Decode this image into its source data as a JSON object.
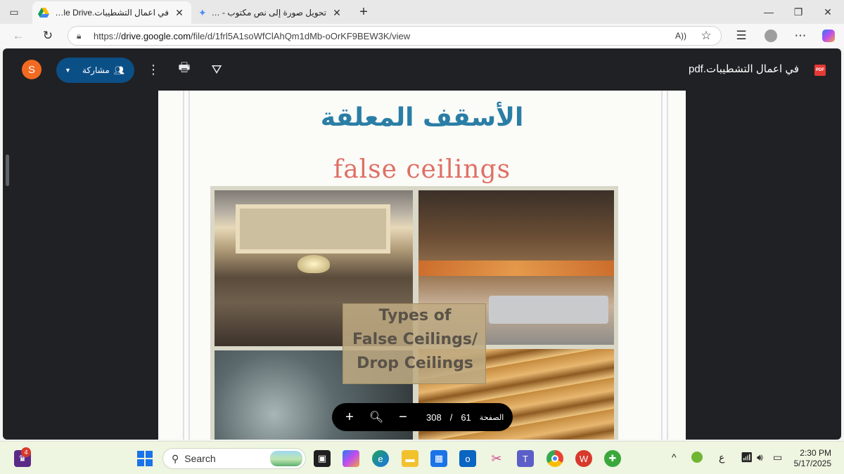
{
  "browser": {
    "tabs": [
      {
        "label": "في اعمال التشطيبات.pdf - Google Drive",
        "close": "✕"
      },
      {
        "label": "تحويل صورة إلى نص مكتوب - Gemini",
        "close": "✕"
      }
    ],
    "new_tab": "+",
    "window_controls": {
      "minimize": "—",
      "restore": "❐",
      "close": "✕"
    },
    "url": {
      "prefix": "https://",
      "host": "drive.google.com",
      "path": "/file/d/1frl5A1soWfClAhQm1dMb-oOrKF9BEW3K/view"
    },
    "nav": {
      "back": "←",
      "reload": "↻"
    }
  },
  "viewer": {
    "avatar_letter": "S",
    "share_label": "مشاركة",
    "title": "في اعمال التشطيبات.pdf",
    "pdf_badge": "PDF"
  },
  "document": {
    "arabic_title": "الأسقف المعلقة",
    "english_title": "false ceilings",
    "overlay_lines": [
      "Types of",
      "False Ceilings/",
      "Drop Ceilings"
    ]
  },
  "page_controls": {
    "label": "الصفحة",
    "current": "61",
    "separator": "/",
    "total": "308",
    "zoom_in": "+",
    "zoom_out": "−"
  },
  "taskbar": {
    "search_placeholder": "Search",
    "notification_count": "4",
    "time": "2:30 PM",
    "date": "5/17/2025",
    "ime_indicator": "ع"
  }
}
